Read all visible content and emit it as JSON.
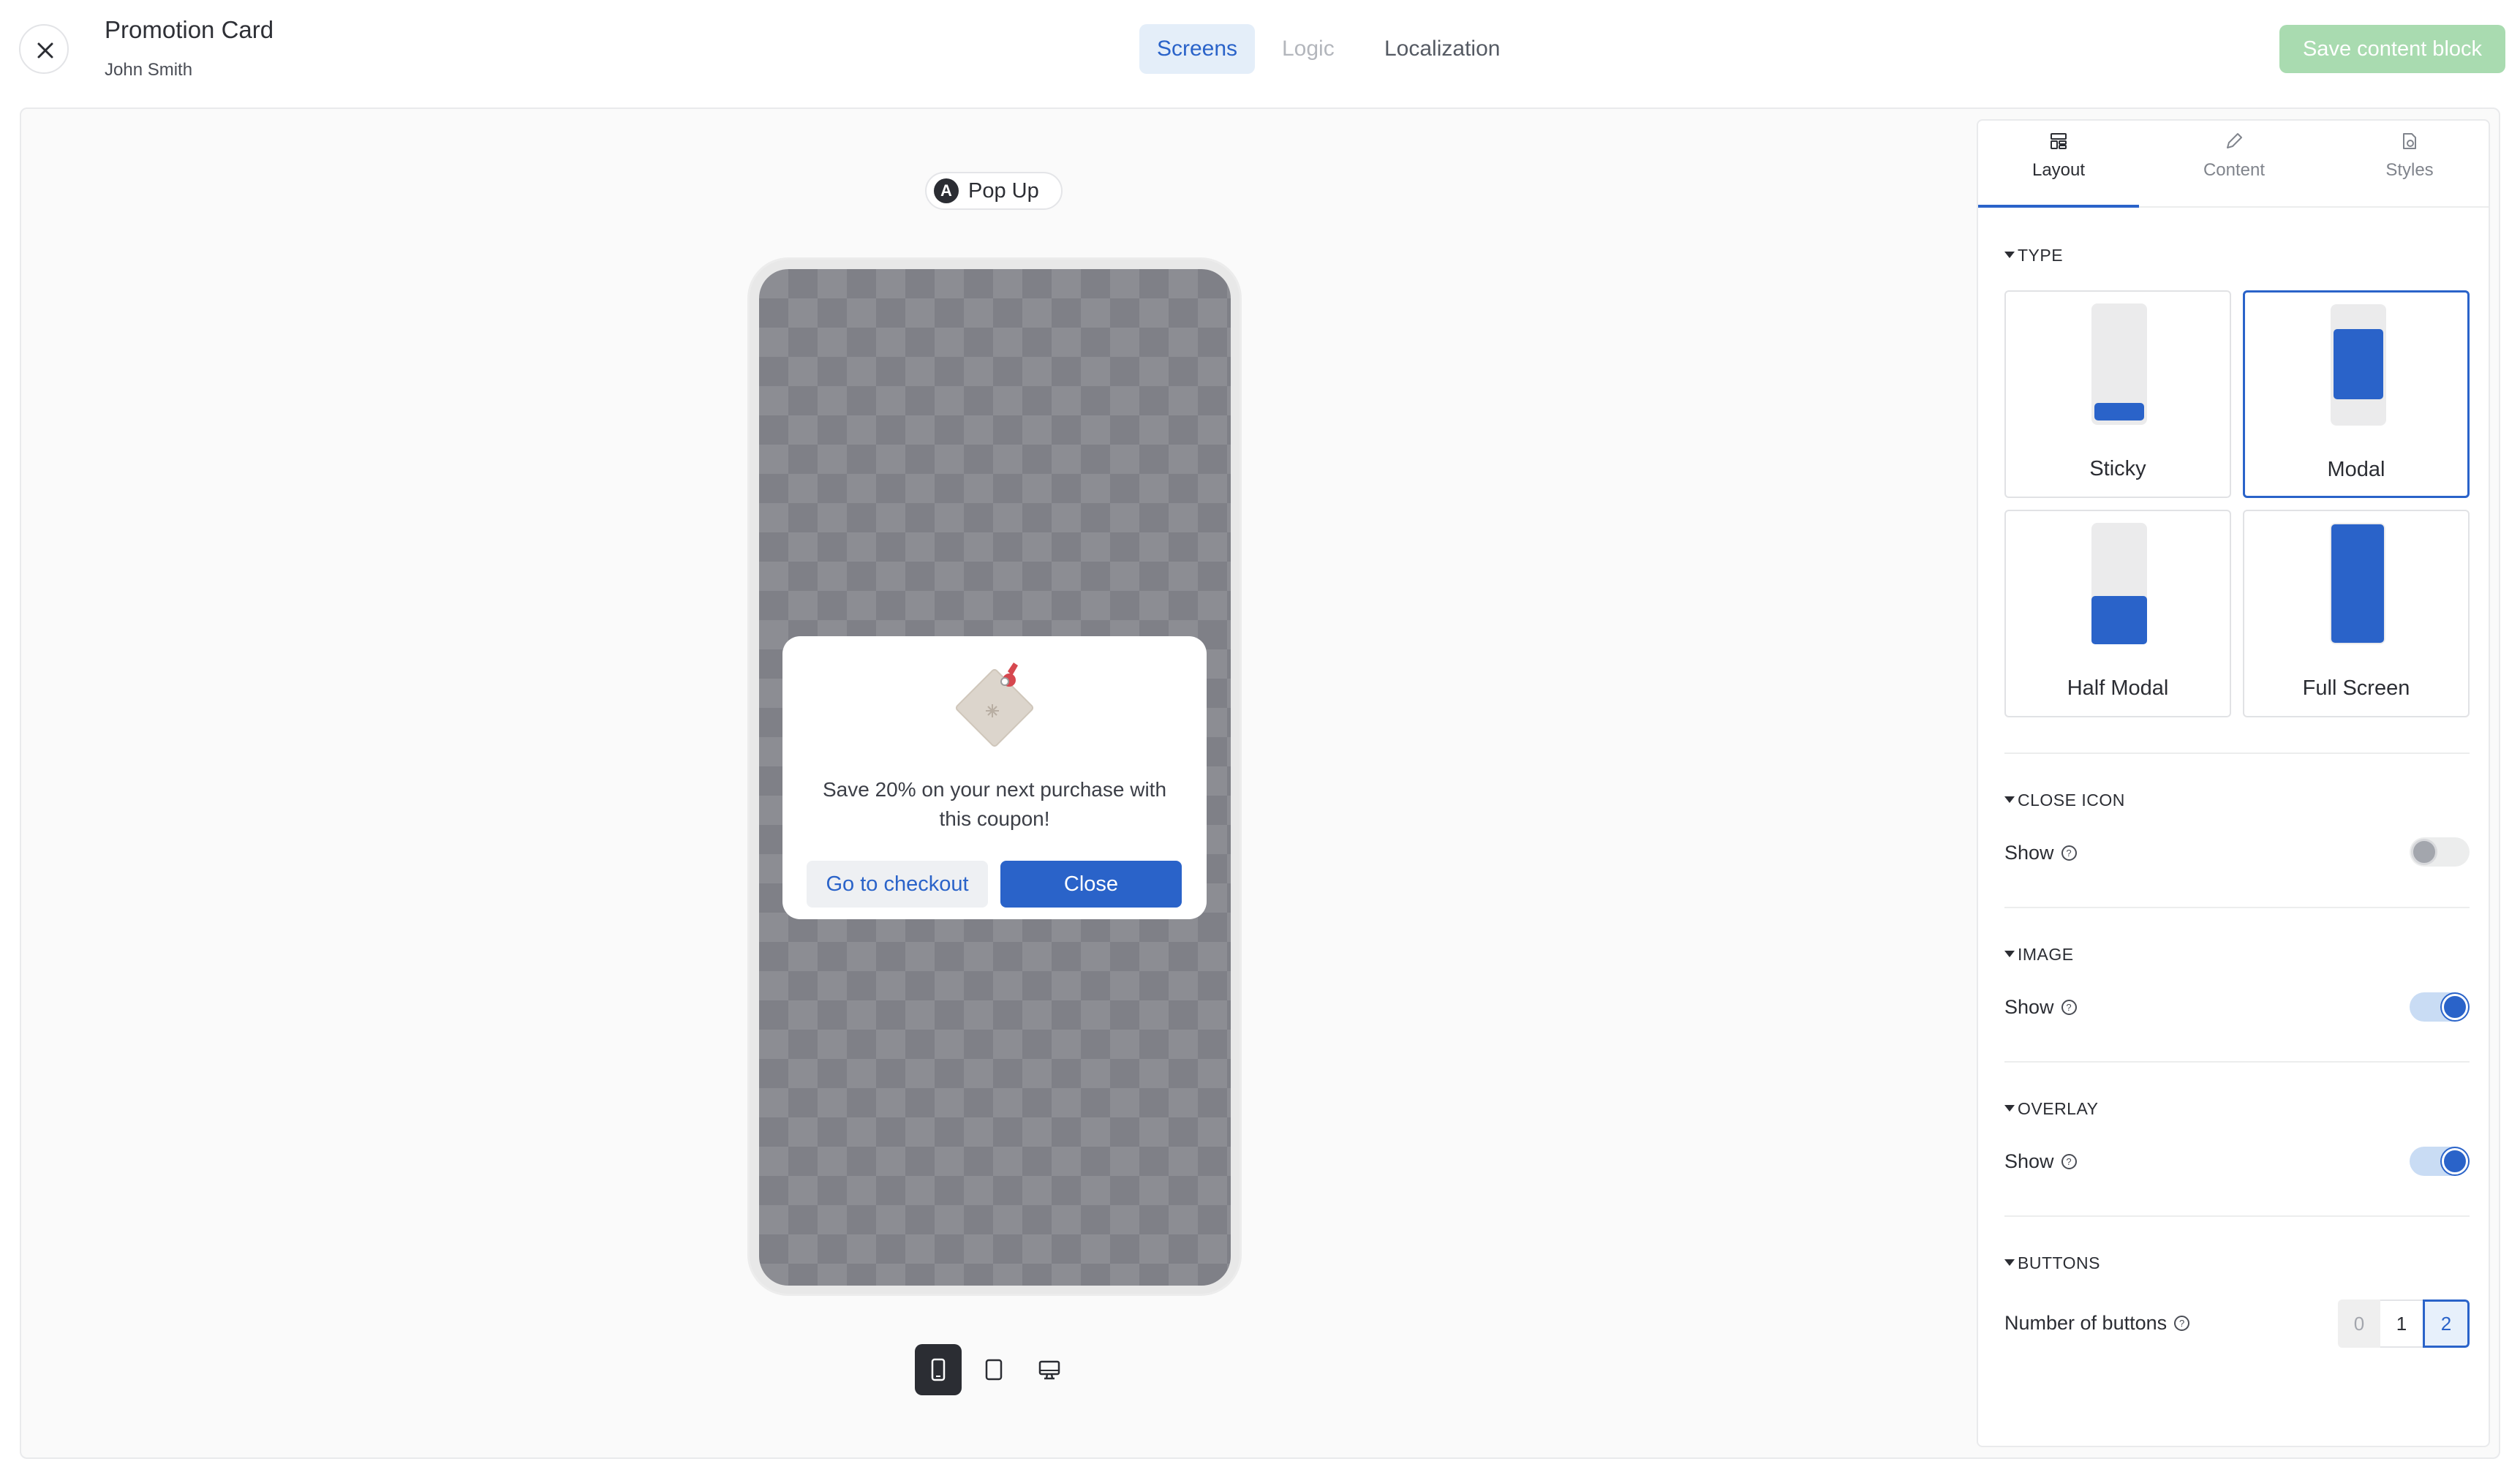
{
  "header": {
    "title": "Promotion Card",
    "subtitle": "John Smith",
    "tabs": [
      {
        "label": "Screens",
        "state": "active"
      },
      {
        "label": "Logic",
        "state": "disabled"
      },
      {
        "label": "Localization",
        "state": "normal"
      }
    ],
    "save_label": "Save content block"
  },
  "preview": {
    "badge_letter": "A",
    "chip_label": "Pop Up",
    "modal": {
      "image_icon": "coupon-tag-icon",
      "text": "Save 20% on your next purchase with this coupon!",
      "secondary_button": "Go to checkout",
      "primary_button": "Close"
    },
    "devices": [
      {
        "icon": "phone-icon",
        "active": true
      },
      {
        "icon": "tablet-icon",
        "active": false
      },
      {
        "icon": "desktop-icon",
        "active": false
      }
    ]
  },
  "panel": {
    "tabs": [
      {
        "label": "Layout",
        "icon": "layout-icon",
        "active": true
      },
      {
        "label": "Content",
        "icon": "pencil-icon",
        "active": false
      },
      {
        "label": "Styles",
        "icon": "styles-icon",
        "active": false
      }
    ],
    "type_section": {
      "heading": "TYPE",
      "options": [
        {
          "label": "Sticky",
          "selected": false
        },
        {
          "label": "Modal",
          "selected": true
        },
        {
          "label": "Half Modal",
          "selected": false
        },
        {
          "label": "Full Screen",
          "selected": false
        }
      ]
    },
    "close_icon": {
      "heading": "CLOSE ICON",
      "label": "Show",
      "enabled": false
    },
    "image": {
      "heading": "IMAGE",
      "label": "Show",
      "enabled": true
    },
    "overlay": {
      "heading": "OVERLAY",
      "label": "Show",
      "enabled": true
    },
    "buttons": {
      "heading": "BUTTONS",
      "label": "Number of buttons",
      "options": [
        "0",
        "1",
        "2"
      ],
      "selected": "2"
    }
  },
  "colors": {
    "accent": "#2a63c9",
    "save_button_bg": "#a9dbb0",
    "overlay": "#8c8d93"
  }
}
